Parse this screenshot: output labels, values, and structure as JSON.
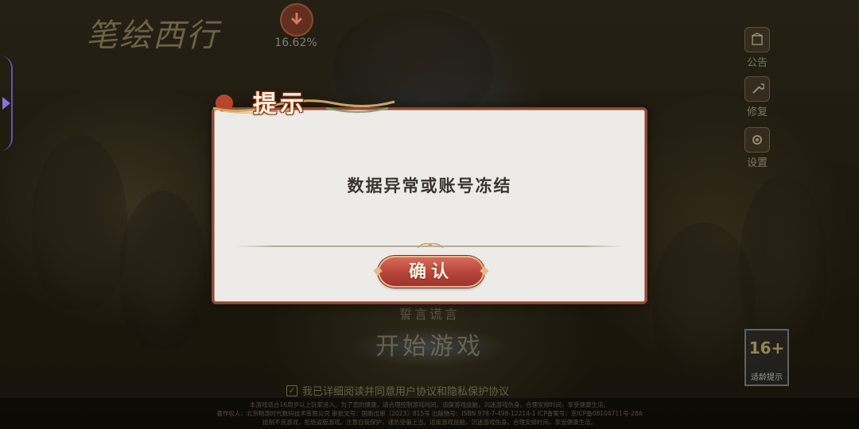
{
  "dialog": {
    "title": "提示",
    "message": "数据异常或账号冻结",
    "confirm_label": "确认"
  },
  "background": {
    "logo_text": "笔绘西行",
    "download_progress": "16.62%",
    "side_menu": [
      {
        "label": "公告",
        "icon": "notice-icon"
      },
      {
        "label": "修复",
        "icon": "repair-icon"
      },
      {
        "label": "设置",
        "icon": "gear-icon"
      }
    ],
    "server_name": "誓言谎言",
    "start_label": "开始游戏",
    "agreement": "我已详细阅读并同意用户协议和隐私保护协议",
    "legal_lines": [
      "本游戏适合16周岁以上玩家进入。为了您的健康，请合理控制游戏时间。适度游戏益脑，沉迷游戏伤身。合理安排时间，享受健康生活。",
      "著作权人：北京畅游时代数码技术有限公司 审批文号：国新出审〔2023〕815号 出版物号：ISBN 978-7-498-12214-1 ICP备案号：京ICP备08104711号-28A",
      "抵制不良游戏，拒绝盗版游戏。注意自我保护，谨防受骗上当。适度游戏益脑，沉迷游戏伤身。合理安排时间，享受健康生活。"
    ],
    "age_rating": "16+",
    "age_label": "适龄提示"
  },
  "colors": {
    "dialog_bg": "#ecebe7",
    "dialog_border": "#8a4a3a",
    "confirm_button": "#b6443a",
    "message_text": "#3a3530"
  }
}
